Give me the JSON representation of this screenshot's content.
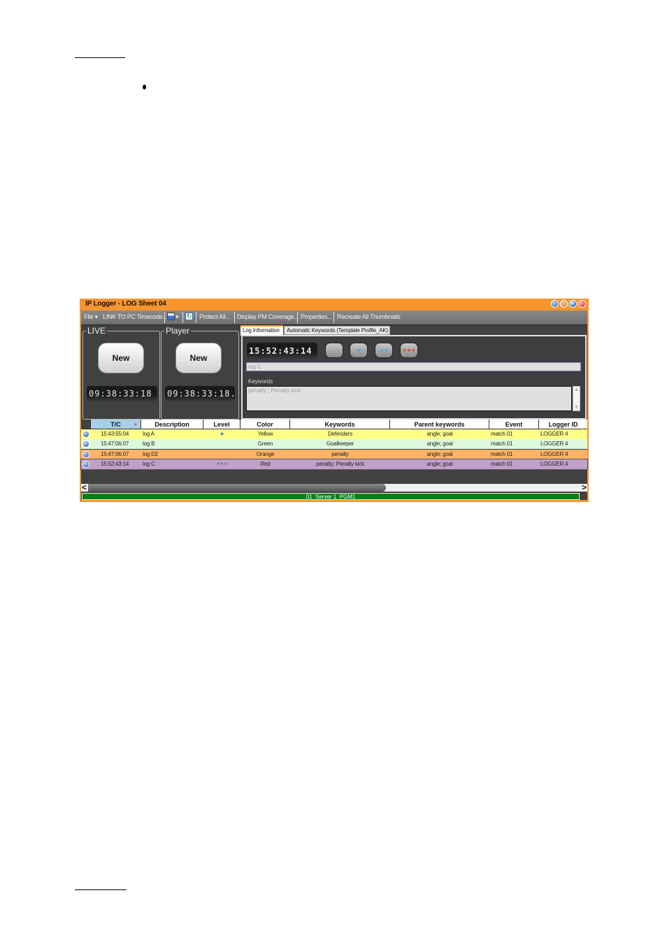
{
  "page": {
    "bullet": "•"
  },
  "window": {
    "title": "IP Logger - LOG Sheet 04",
    "title_buttons": [
      {
        "name": "help-button",
        "color": "#3a7fd0"
      },
      {
        "name": "minimize-button",
        "color": "#c89060"
      },
      {
        "name": "maximize-button",
        "color": "#2f74d0"
      },
      {
        "name": "close-button",
        "color": "#d03a3a"
      }
    ]
  },
  "toolbar": {
    "file": "File ▾",
    "link_pc_timecode": "LINK TO PC Timecode...",
    "calendar_dropdown": "▾",
    "protect_all": "Protect All...",
    "display_pm_coverage": "Display PM Coverage...",
    "properties": "Properties...",
    "recreate_thumbnails": "Recreate All Thumbnails"
  },
  "live": {
    "label": "LIVE",
    "new_button": "New",
    "timecode": "09:38:33:18"
  },
  "player": {
    "label": "Player",
    "new_button": "New",
    "timecode": "09:38:33:18."
  },
  "tabs": [
    {
      "label": "Log Information",
      "active": true
    },
    {
      "label": "Automatic Keywords (Template Profile_AK)",
      "active": false
    }
  ],
  "log_info": {
    "timecode": "15:52:43:14",
    "level_buttons": [
      {
        "name": "level-0-button",
        "stars": ""
      },
      {
        "name": "level-1-button",
        "stars": "★"
      },
      {
        "name": "level-2-button",
        "stars": "★★"
      },
      {
        "name": "level-3-button",
        "stars": "★★★"
      }
    ],
    "description_value": "log C",
    "keywords_label": "Keywords",
    "keywords_value": "penalty ;  Penalty kick"
  },
  "grid": {
    "columns": [
      "",
      "T/C",
      "Description",
      "Level",
      "Color",
      "Keywords",
      "Parent keywords",
      "Event",
      "Logger ID"
    ],
    "sort_indicator": "▲",
    "rows": [
      {
        "tc": "15:43:55:04",
        "description": "log A",
        "level": "★",
        "color": "Yellow",
        "keywords": "Defenders",
        "parent_keywords": "angle; goal",
        "event": "match 01",
        "logger_id": "LOGGER 4",
        "bg": "#ffff88"
      },
      {
        "tc": "15:47:06:07",
        "description": "log B",
        "level": "",
        "color": "Green",
        "keywords": "Goalkeeper",
        "parent_keywords": "angle; goal",
        "event": "match 01",
        "logger_id": "LOGGER 4",
        "bg": "#ddfadd"
      },
      {
        "tc": "15:47:06:07",
        "description": "log D2",
        "level": "",
        "color": "Orange",
        "keywords": "penalty",
        "parent_keywords": "angle; goal",
        "event": "match 01",
        "logger_id": "LOGGER 4",
        "bg": "#ffb366"
      },
      {
        "tc": "15:52:43:14",
        "description": "log C",
        "level": "★★★",
        "color": "Red",
        "keywords": "penalty; Penalty kick",
        "parent_keywords": "angle; goal",
        "event": "match 01",
        "logger_id": "LOGGER 4",
        "bg": "#c0a0c8"
      }
    ]
  },
  "scrollbar": {
    "left_arrow": "<",
    "right_arrow": ">"
  },
  "status": {
    "channel": "01_Server 1_PGM1"
  }
}
